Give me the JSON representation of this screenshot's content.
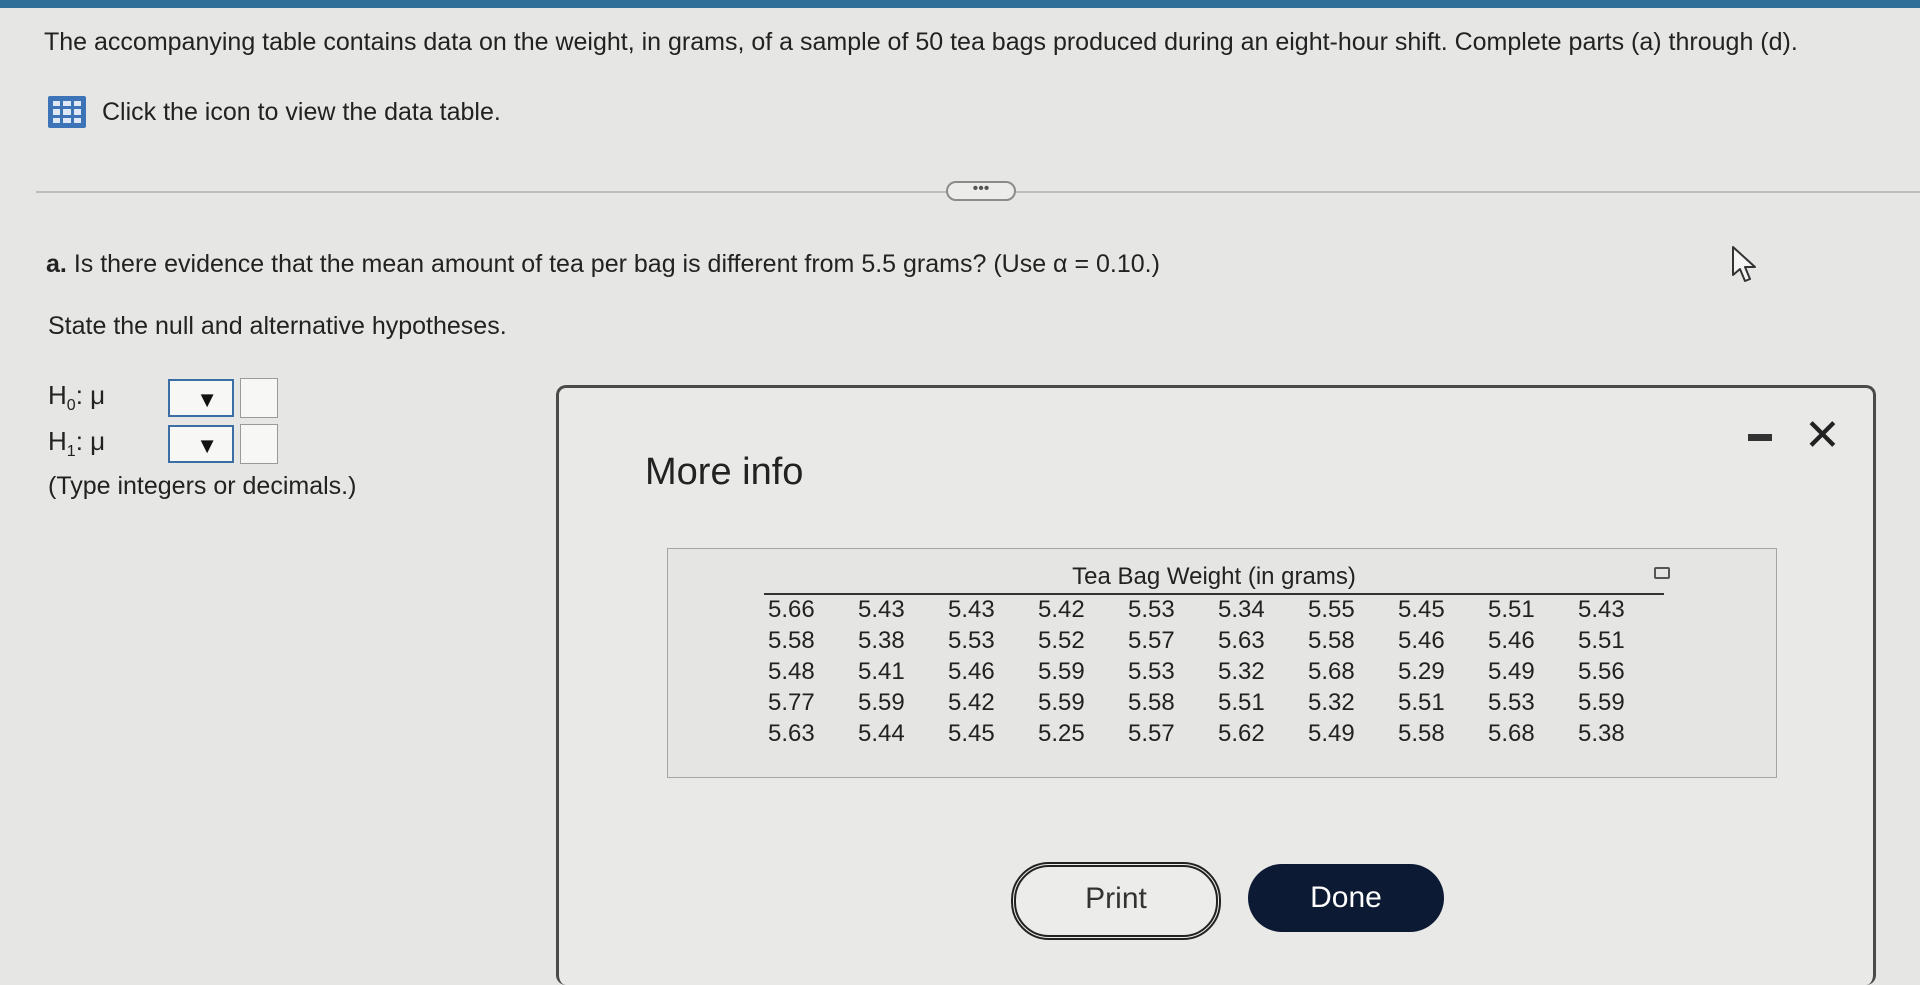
{
  "header": {
    "intro": "The accompanying table contains data on the weight, in grams, of a sample of 50 tea bags produced during an eight-hour shift. Complete parts (a) through (d).",
    "table_link": "Click the icon to view the data table.",
    "more_button": "•••"
  },
  "question": {
    "part_label": "a.",
    "text": "Is there evidence that the mean amount of tea per bag is different from 5.5 grams? (Use α = 0.10.)",
    "instruction": "State the null and alternative hypotheses.",
    "h0_symbol": "H",
    "h0_sub": "0",
    "h0_suffix": ": μ",
    "h1_symbol": "H",
    "h1_sub": "1",
    "h1_suffix": ": μ",
    "dropdown_arrow": "▼",
    "hint": "(Type integers or decimals.)"
  },
  "modal": {
    "title": "More info",
    "table_title": "Tea Bag Weight (in grams)",
    "rows": [
      [
        "5.66",
        "5.43",
        "5.43",
        "5.42",
        "5.53",
        "5.34",
        "5.55",
        "5.45",
        "5.51",
        "5.43"
      ],
      [
        "5.58",
        "5.38",
        "5.53",
        "5.52",
        "5.57",
        "5.63",
        "5.58",
        "5.46",
        "5.46",
        "5.51"
      ],
      [
        "5.48",
        "5.41",
        "5.46",
        "5.59",
        "5.53",
        "5.32",
        "5.68",
        "5.29",
        "5.49",
        "5.56"
      ],
      [
        "5.77",
        "5.59",
        "5.42",
        "5.59",
        "5.58",
        "5.51",
        "5.32",
        "5.51",
        "5.53",
        "5.59"
      ],
      [
        "5.63",
        "5.44",
        "5.45",
        "5.25",
        "5.57",
        "5.62",
        "5.49",
        "5.58",
        "5.68",
        "5.38"
      ]
    ],
    "print_label": "Print",
    "done_label": "Done",
    "close_glyph": "✕"
  },
  "colors": {
    "accent": "#3d74b8",
    "done_button": "#0c1a33",
    "top_strip": "#2f6f98"
  },
  "icons": [
    "table-grid-icon",
    "mouse-cursor-icon",
    "minimize-icon",
    "close-icon",
    "copy-icon"
  ]
}
